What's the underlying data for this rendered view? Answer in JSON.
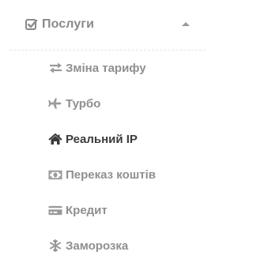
{
  "colors": {
    "text_muted": "#8f8f8f",
    "text_active": "#3b3b3b",
    "icon_muted": "#9a9a9a"
  },
  "menu": {
    "header": {
      "label": "Послуги",
      "icon": "check-square-icon",
      "toggle_icon": "caret-up-icon"
    },
    "items": [
      {
        "label": "Зміна тарифу",
        "icon": "exchange-icon",
        "active": false
      },
      {
        "label": "Турбо",
        "icon": "plane-icon",
        "active": false
      },
      {
        "label": "Реальний IP",
        "icon": "home-icon",
        "active": true
      },
      {
        "label": "Переказ коштів",
        "icon": "money-icon",
        "active": false
      },
      {
        "label": "Кредит",
        "icon": "credit-card-icon",
        "active": false
      },
      {
        "label": "Заморозка",
        "icon": "snowflake-icon",
        "active": false
      }
    ]
  }
}
